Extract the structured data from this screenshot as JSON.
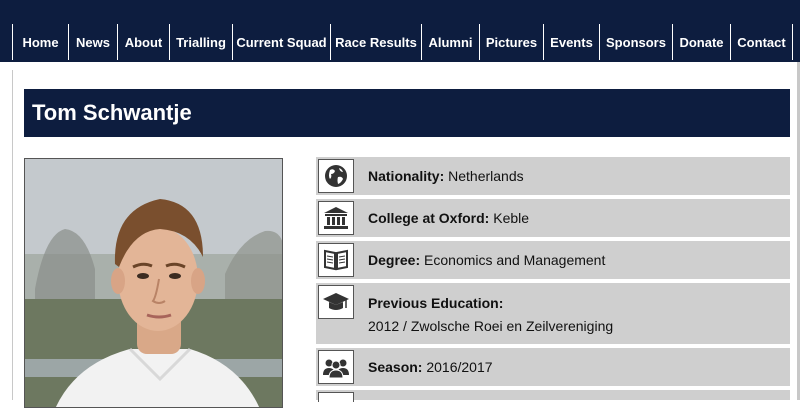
{
  "nav": {
    "items": [
      {
        "label": "Home"
      },
      {
        "label": "News"
      },
      {
        "label": "About"
      },
      {
        "label": "Trialling"
      },
      {
        "label": "Current Squad"
      },
      {
        "label": "Race Results"
      },
      {
        "label": "Alumni"
      },
      {
        "label": "Pictures"
      },
      {
        "label": "Events"
      },
      {
        "label": "Sponsors"
      },
      {
        "label": "Donate"
      },
      {
        "label": "Contact"
      }
    ]
  },
  "profile": {
    "name": "Tom Schwantje",
    "nationality": {
      "label": "Nationality:",
      "value": "Netherlands",
      "icon": "globe-icon"
    },
    "college": {
      "label": "College at Oxford:",
      "value": "Keble",
      "icon": "college-building-icon"
    },
    "degree": {
      "label": "Degree:",
      "value": "Economics and Management",
      "icon": "open-book-icon"
    },
    "previous_education": {
      "label": "Previous Education:",
      "value": "2012 / Zwolsche Roei en Zeilvereniging",
      "icon": "graduation-cap-icon"
    },
    "season": {
      "label": "Season:",
      "value": "2016/2017",
      "icon": "group-icon"
    }
  },
  "colors": {
    "navy": "#0d1d3f",
    "row_gray": "#cfcfcf"
  }
}
